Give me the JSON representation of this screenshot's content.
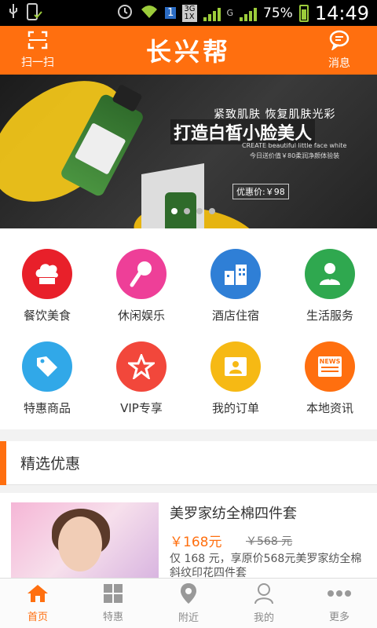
{
  "status_bar": {
    "battery": "75%",
    "network_3g": "3G",
    "network_1x": "1X",
    "network_g": "G",
    "time": "14:49"
  },
  "header": {
    "title": "长兴帮",
    "scan_label": "扫一扫",
    "message_label": "消息"
  },
  "banner": {
    "line1": "紧致肌肤 恢复肌肤光彩",
    "line2": "打造白皙小脸美人",
    "line3": "CREATE beautiful little face white",
    "line4": "今日送价值￥80柔润净颜体验装",
    "price": "优惠价:￥98",
    "dots": 4,
    "active_dot": 1
  },
  "categories": [
    {
      "label": "餐饮美食",
      "icon": "chef-hat-icon",
      "color": "#e8202a"
    },
    {
      "label": "休闲娱乐",
      "icon": "microphone-icon",
      "color": "#ee3f98"
    },
    {
      "label": "酒店住宿",
      "icon": "building-icon",
      "color": "#2f7fd6"
    },
    {
      "label": "生活服务",
      "icon": "service-person-icon",
      "color": "#2fa84f"
    },
    {
      "label": "特惠商品",
      "icon": "price-tag-icon",
      "color": "#31a8e8"
    },
    {
      "label": "VIP专享",
      "icon": "star-icon",
      "color": "#f2473b"
    },
    {
      "label": "我的订单",
      "icon": "id-card-icon",
      "color": "#f6b914"
    },
    {
      "label": "本地资讯",
      "icon": "news-icon",
      "color": "#ff6f0f"
    }
  ],
  "section": {
    "title": "精选优惠"
  },
  "deal": {
    "title": "美罗家纺全棉四件套",
    "price": "￥168元",
    "original_price": "￥568 元",
    "description": "仅 168 元，享原价568元美罗家纺全棉斜纹印花四件套"
  },
  "bottom_nav": [
    {
      "label": "首页",
      "icon": "home-icon",
      "active": true
    },
    {
      "label": "特惠",
      "icon": "grid-icon",
      "active": false
    },
    {
      "label": "附近",
      "icon": "location-pin-icon",
      "active": false
    },
    {
      "label": "我的",
      "icon": "user-icon",
      "active": false
    },
    {
      "label": "更多",
      "icon": "more-dots-icon",
      "active": false
    }
  ],
  "colors": {
    "brand": "#ff6f0f",
    "status_green": "#9ccc3b"
  }
}
